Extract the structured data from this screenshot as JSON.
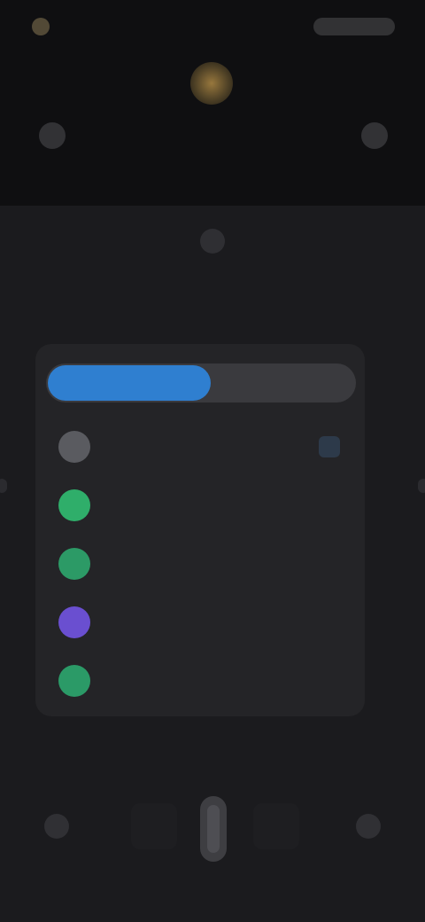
{
  "status_bar": {
    "left_text": "",
    "right_indicator": "status-icons"
  },
  "header": {
    "left_label": "",
    "right_label": ""
  },
  "segmented": {
    "active": "",
    "inactive": ""
  },
  "rows": [
    {
      "label": "",
      "meta": "",
      "color": "#5a5b60",
      "icon": "user-avatar"
    },
    {
      "label": "",
      "meta": "",
      "color": "#2fae6a",
      "icon": "user-avatar"
    },
    {
      "label": "",
      "meta": "",
      "color": "#2c9a66",
      "icon": "user-avatar"
    },
    {
      "label": "",
      "meta": "",
      "color": "#6a4fd0",
      "icon": "user-avatar"
    },
    {
      "label": "",
      "meta": "",
      "color": "#2b9a67",
      "icon": "user-avatar"
    }
  ],
  "bottom": {
    "label": ""
  },
  "colors": {
    "accent": "#2f7fd0",
    "background": "#0f0f11",
    "panel": "#1b1b1e",
    "card": "#242427"
  }
}
